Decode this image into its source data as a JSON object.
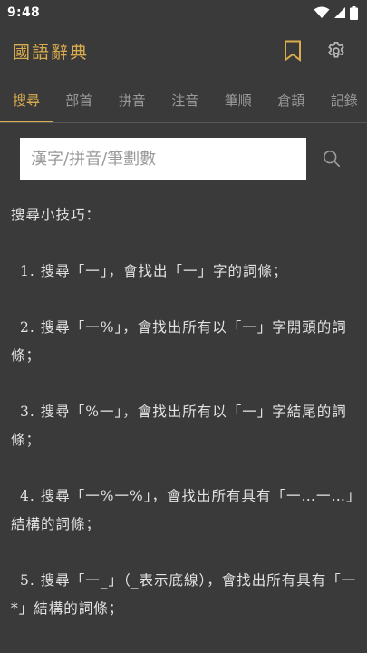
{
  "status": {
    "time": "9:48"
  },
  "app": {
    "title": "國語辭典"
  },
  "tabs": [
    {
      "label": "搜尋",
      "active": true
    },
    {
      "label": "部首",
      "active": false
    },
    {
      "label": "拼音",
      "active": false
    },
    {
      "label": "注音",
      "active": false
    },
    {
      "label": "筆順",
      "active": false
    },
    {
      "label": "倉頡",
      "active": false
    },
    {
      "label": "記錄",
      "active": false
    }
  ],
  "search": {
    "placeholder": "漢字/拼音/筆劃數",
    "value": ""
  },
  "tips": {
    "heading": "搜尋小技巧：",
    "items": [
      {
        "num": "1.",
        "text": "搜尋「一」，會找出「一」字的詞條；"
      },
      {
        "num": "2.",
        "text": "搜尋「一%」，會找出所有以「一」字開頭的詞條；"
      },
      {
        "num": "3.",
        "text": "搜尋「%一」，會找出所有以「一」字結尾的詞條；"
      },
      {
        "num": "4.",
        "text": "搜尋「一%一%」，會找出所有具有「一…一…」結構的詞條；"
      },
      {
        "num": "5.",
        "text": "搜尋「一_」（_表示底線），會找出所有具有「一*」結構的詞條；"
      }
    ]
  },
  "colors": {
    "background": "#3a3a3a",
    "accent": "#d9ac4e",
    "tab_inactive": "#9a9a9a"
  },
  "icons": {
    "wifi": "wifi-icon",
    "signal": "signal-icon",
    "battery": "battery-icon",
    "bookmark": "bookmark-icon",
    "settings": "gear-icon",
    "search": "search-icon"
  }
}
